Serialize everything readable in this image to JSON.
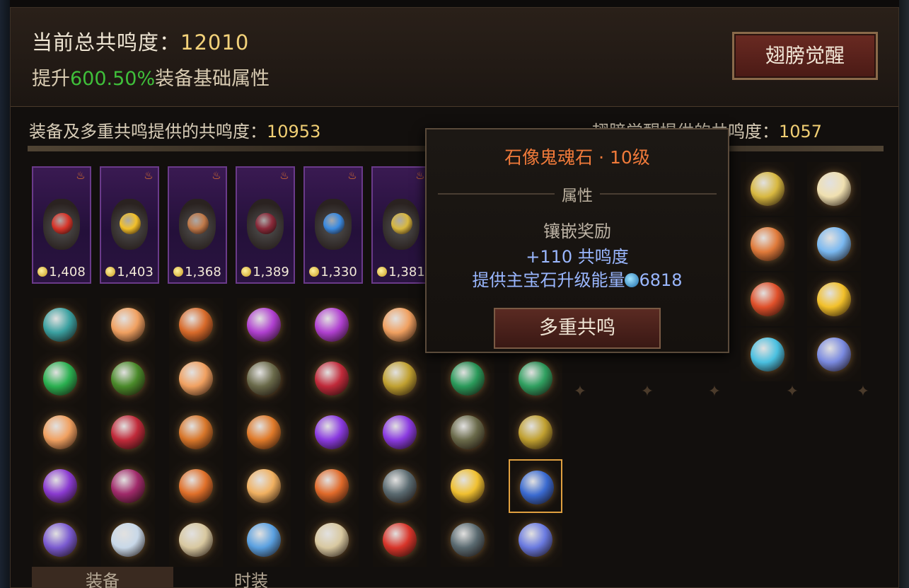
{
  "header": {
    "title_label": "当前总共鸣度：",
    "title_value": "12010",
    "sub_prefix": "提升",
    "sub_percent": "600.50%",
    "sub_suffix": "装备基础属性",
    "awaken_button": "翅膀觉醒"
  },
  "stats": {
    "left_label": "装备及多重共鸣提供的共鸣度：",
    "left_value": "10953",
    "right_label": "翅膀觉醒提供的共鸣度：",
    "right_value": "1057"
  },
  "equipment": [
    {
      "price": "1,408",
      "core_color": "#d8352a"
    },
    {
      "price": "1,403",
      "core_color": "#f2c02a"
    },
    {
      "price": "1,368",
      "core_color": "#c07a4a"
    },
    {
      "price": "1,389",
      "core_color": "#8a2a3a"
    },
    {
      "price": "1,330",
      "core_color": "#3a8ae0"
    },
    {
      "price": "1,381",
      "core_color": "#d8b840"
    }
  ],
  "gems_rows": [
    [
      "#3aa0a0",
      "#f0a060",
      "#d86a2a",
      "#b040d0",
      "#b040d0",
      "#f0a060"
    ],
    [
      "#2ab050",
      "#4a8a2a",
      "#f0a060",
      "#6a6a4a",
      "#c02a3a",
      "#c0a030",
      "#2a9a5a",
      "#30a060"
    ],
    [
      "#f0a060",
      "#c02a3a",
      "#d8762a",
      "#e07a2a",
      "#8a3ae0",
      "#8a3ae0",
      "#6a6a4a",
      "#c0a030"
    ],
    [
      "#8a3ad0",
      "#a02a6a",
      "#e0702a",
      "#f0b060",
      "#e06a2a",
      "#5a6a70",
      "#f0c030",
      "#3a6ad0"
    ],
    [
      "#7a5ad0",
      "#c8d8e8",
      "#d8c8a0",
      "#5aa0e0",
      "#d8c8a0",
      "#d8352a",
      "#5a6a70",
      "#6a7ae0"
    ]
  ],
  "right_items": [
    [
      "#d8b840",
      "#f0e0b0"
    ],
    [
      "#e07a3a",
      "#7ab8f0"
    ],
    [
      "#e0502a",
      "#f2c02a"
    ],
    [
      "#4ac0e0",
      "#7a8ae0"
    ]
  ],
  "tooltip": {
    "title": "石像鬼魂石 · 10级",
    "attr_heading": "属性",
    "line1": "镶嵌奖励",
    "line2": "+110 共鸣度",
    "line3_prefix": "提供主宝石升级能量",
    "line3_value": "6818",
    "button": "多重共鸣"
  },
  "tabs": [
    "装备",
    "时装"
  ],
  "icons": {
    "coin": "coin-icon",
    "badge": "flame-badge-icon",
    "energy": "energy-orb-icon"
  },
  "colors": {
    "accent_green": "#3fbf3a",
    "accent_gold": "#f3d27a",
    "tooltip_title": "#f07a3a",
    "tooltip_blue": "#9ab7ff"
  }
}
